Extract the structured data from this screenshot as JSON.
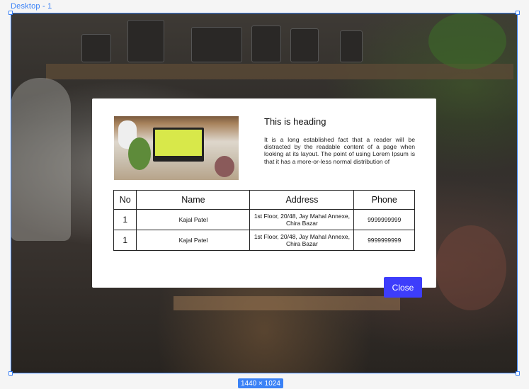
{
  "frame": {
    "label": "Desktop - 1",
    "size_badge": "1440 × 1024"
  },
  "modal": {
    "heading": "This is heading",
    "paragraph": "It is a long established fact that a reader will be distracted by the readable content of a page when looking at its layout. The point of using Lorem Ipsum is that it has a more-or-less normal distribution of",
    "table": {
      "headers": [
        "No",
        "Name",
        "Address",
        "Phone"
      ],
      "rows": [
        [
          "1",
          "Kajal Patel",
          "1st Floor, 20/48, Jay Mahal Annexe, Chira Bazar",
          "9999999999"
        ],
        [
          "1",
          "Kajal Patel",
          "1st Floor, 20/48, Jay Mahal Annexe, Chira Bazar",
          "9999999999"
        ]
      ]
    },
    "close_label": "Close"
  },
  "colors": {
    "selection": "#3b82f6",
    "button": "#3d3dfb"
  }
}
